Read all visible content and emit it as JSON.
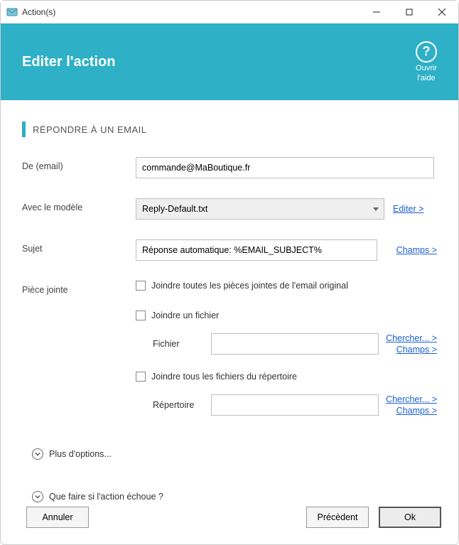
{
  "window": {
    "title": "Action(s)"
  },
  "header": {
    "title": "Editer l'action",
    "help": {
      "open": "Ouvrir",
      "guide": "l'aide"
    }
  },
  "section": {
    "title": "RÉPONDRE À UN EMAIL"
  },
  "form": {
    "from_label": "De (email)",
    "from_value": "commande@MaBoutique.fr",
    "model_label": "Avec le modèle",
    "model_value": "Reply-Default.txt",
    "edit_link": "Editer >",
    "subject_label": "Sujet",
    "subject_value": "Réponse automatique: %EMAIL_SUBJECT%",
    "fields_link": "Champs >",
    "attachment_label": "Pièce jointe",
    "attach_original": "Joindre toutes les pièces jointes de l'email original",
    "attach_file": "Joindre un fichier",
    "file_label": "Fichier",
    "browse_link": "Chercher... >",
    "attach_dir": "Joindre tous les fichiers du répertoire",
    "dir_label": "Répertoire"
  },
  "expanders": {
    "more": "Plus d'options...",
    "failure": "Que faire si l'action échoue ?"
  },
  "footer": {
    "cancel": "Annuler",
    "prev": "Précèdent",
    "ok": "Ok"
  }
}
